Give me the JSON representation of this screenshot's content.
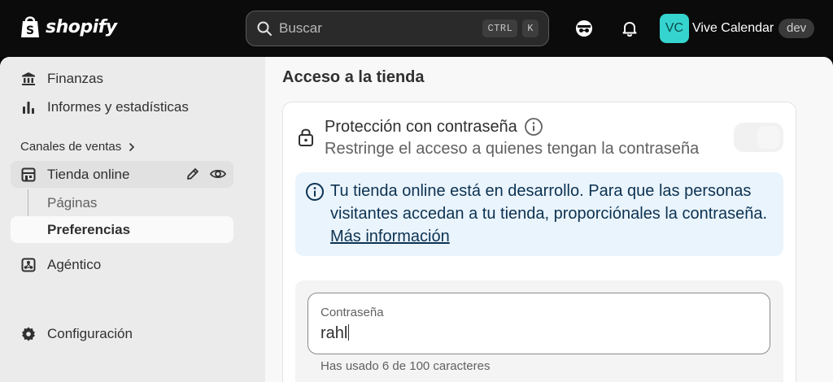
{
  "topbar": {
    "brand": "shopify",
    "search_placeholder": "Buscar",
    "shortcut_ctrl": "CTRL",
    "shortcut_key": "K",
    "avatar_initials": "VC",
    "store_name": "Vive Calendar",
    "env_badge": "dev"
  },
  "sidebar": {
    "items": [
      {
        "label": "Finanzas",
        "icon": "bank-icon"
      },
      {
        "label": "Informes y estadísticas",
        "icon": "bar-chart-icon"
      }
    ],
    "section_label": "Canales de ventas",
    "channel": {
      "label": "Tienda online",
      "icon": "store-icon"
    },
    "sub_items": [
      {
        "label": "Páginas"
      },
      {
        "label": "Preferencias"
      }
    ],
    "agentic": {
      "label": "Agéntico",
      "icon": "agentic-icon"
    },
    "settings": {
      "label": "Configuración",
      "icon": "gear-icon"
    }
  },
  "content": {
    "title": "Acceso a la tienda",
    "protection_title": "Protección con contraseña",
    "protection_subtitle": "Restringe el acceso a quienes tengan la contraseña",
    "banner_text": "Tu tienda online está en desarrollo. Para que las personas visitantes accedan a tu tienda, proporciónales la contraseña.",
    "banner_link": "Más información",
    "password_label": "Contraseña",
    "password_value": "rahl",
    "password_help": "Has usado 6 de 100 caracteres"
  },
  "colors": {
    "avatar_bg": "#35d4cf",
    "banner_bg": "#eaf4fc",
    "topbar_bg": "#0b0b0b"
  }
}
